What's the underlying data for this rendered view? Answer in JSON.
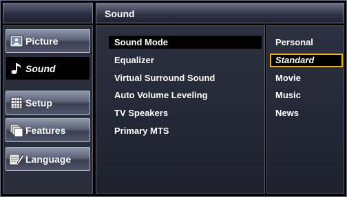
{
  "header": {
    "title": "Sound"
  },
  "sidebar": {
    "items": [
      {
        "label": "Picture",
        "icon": "picture-icon",
        "active": false
      },
      {
        "label": "Sound",
        "icon": "sound-note-icon",
        "active": true
      },
      {
        "label": "Setup",
        "icon": "setup-grid-icon",
        "active": false
      },
      {
        "label": "Features",
        "icon": "features-icon",
        "active": false
      },
      {
        "label": "Language",
        "icon": "language-icon",
        "active": false
      }
    ]
  },
  "menu": {
    "items": [
      {
        "label": "Sound Mode",
        "selected": true
      },
      {
        "label": "Equalizer",
        "selected": false
      },
      {
        "label": "Virtual Surround Sound",
        "selected": false
      },
      {
        "label": "Auto Volume Leveling",
        "selected": false
      },
      {
        "label": "TV Speakers",
        "selected": false
      },
      {
        "label": "Primary MTS",
        "selected": false
      }
    ]
  },
  "options": {
    "items": [
      {
        "label": "Personal",
        "selected": false
      },
      {
        "label": "Standard",
        "selected": true
      },
      {
        "label": "Movie",
        "selected": false
      },
      {
        "label": "Music",
        "selected": false
      },
      {
        "label": "News",
        "selected": false
      }
    ]
  },
  "colors": {
    "highlight_border": "#f0b400",
    "panel_bg": "#2c3040"
  }
}
